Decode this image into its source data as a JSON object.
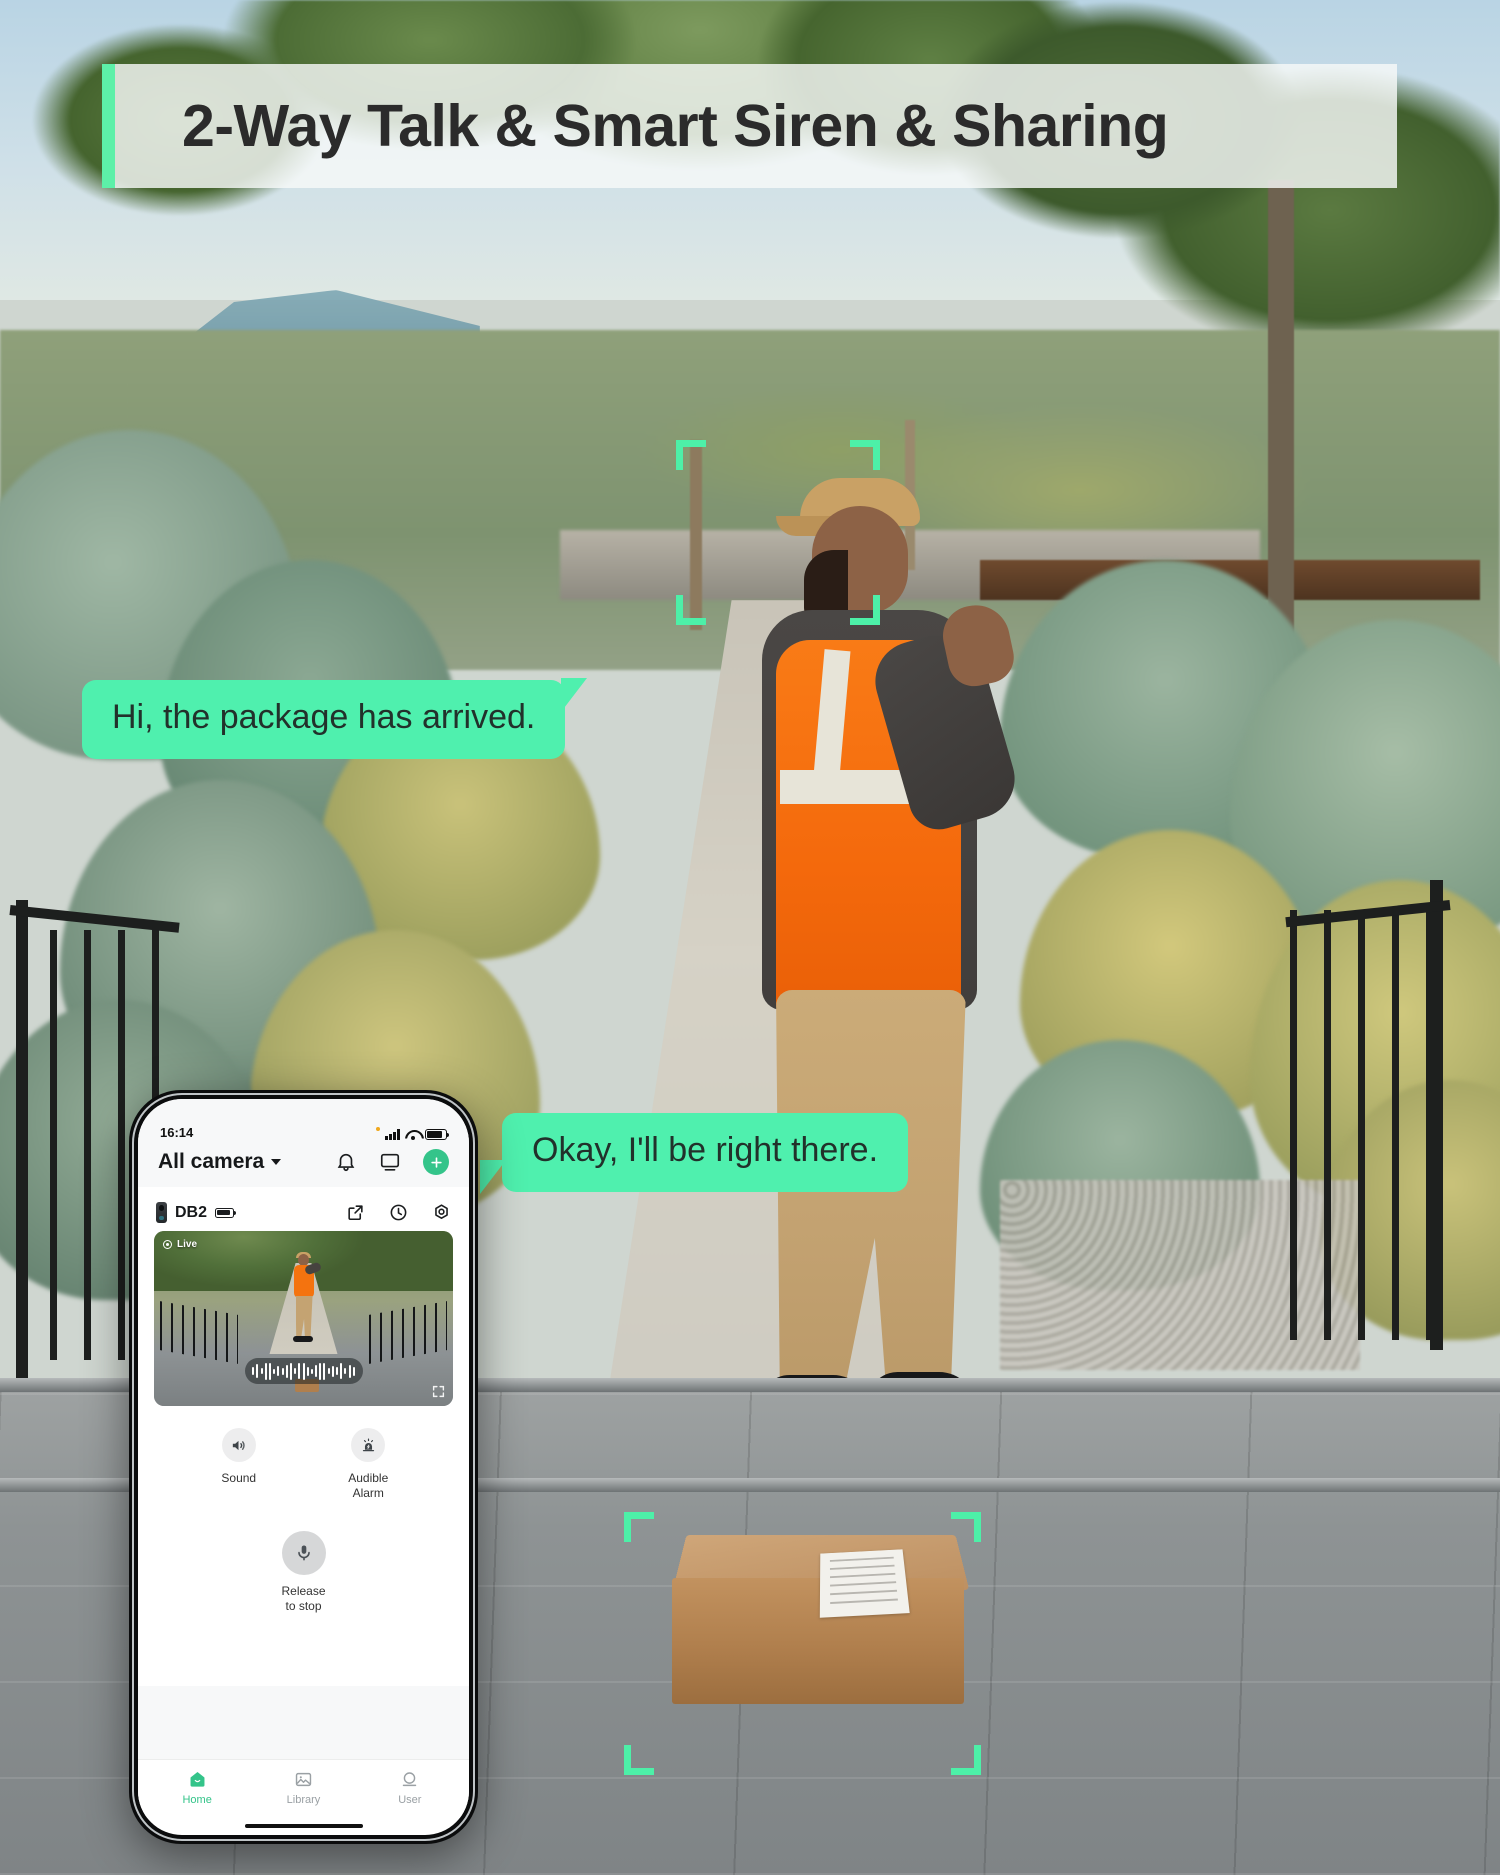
{
  "headline": {
    "text": "2-Way Talk & Smart Siren & Sharing",
    "accent_color": "#5df0a8",
    "text_color": "#2b2b2b"
  },
  "conversation": {
    "bubble_color": "#4ff0ae",
    "messages": [
      {
        "speaker": "visitor",
        "text": "Hi, the package has arrived."
      },
      {
        "speaker": "homeowner",
        "text": "Okay, I'll be right there."
      }
    ]
  },
  "detection": {
    "bracket_color": "#4df0a8",
    "targets": [
      "person",
      "package"
    ]
  },
  "phone": {
    "status_bar": {
      "time": "16:14",
      "signal_icon": "cellular-signal-icon",
      "wifi_icon": "wifi-icon",
      "battery_icon": "battery-icon"
    },
    "header": {
      "title": "All camera",
      "dropdown_icon": "chevron-down-icon",
      "icons": [
        {
          "name": "bell-icon",
          "label": "Notifications"
        },
        {
          "name": "cast-icon",
          "label": "Cast to TV"
        },
        {
          "name": "plus-icon",
          "label": "Add device"
        }
      ],
      "accent_color": "#34c48a"
    },
    "camera_card": {
      "device_icon": "doorbell-icon",
      "device_name": "DB2",
      "battery_icon": "battery-icon",
      "actions": [
        {
          "name": "share-icon",
          "label": "Share"
        },
        {
          "name": "history-clock-icon",
          "label": "History"
        },
        {
          "name": "settings-gear-icon",
          "label": "Settings"
        }
      ],
      "live_view": {
        "badge": "Live",
        "badge_icon": "live-record-icon",
        "waveform_icon": "audio-waveform",
        "fullscreen_icon": "fullscreen-icon"
      }
    },
    "controls": [
      {
        "name": "sound-button",
        "icon": "speaker-icon",
        "label": "Sound"
      },
      {
        "name": "audible-alarm-button",
        "icon": "siren-icon",
        "label": "Audible\nAlarm"
      }
    ],
    "control_labels": {
      "sound": "Sound",
      "alarm_line1": "Audible",
      "alarm_line2": "Alarm"
    },
    "mic": {
      "icon": "microphone-icon",
      "label_line1": "Release",
      "label_line2": "to stop"
    },
    "bottom_nav": [
      {
        "name": "nav-home",
        "icon": "home-icon",
        "label": "Home",
        "active": true
      },
      {
        "name": "nav-library",
        "icon": "image-library-icon",
        "label": "Library",
        "active": false
      },
      {
        "name": "nav-user",
        "icon": "user-icon",
        "label": "User",
        "active": false
      }
    ],
    "nav_labels": {
      "home": "Home",
      "library": "Library",
      "user": "User"
    }
  }
}
